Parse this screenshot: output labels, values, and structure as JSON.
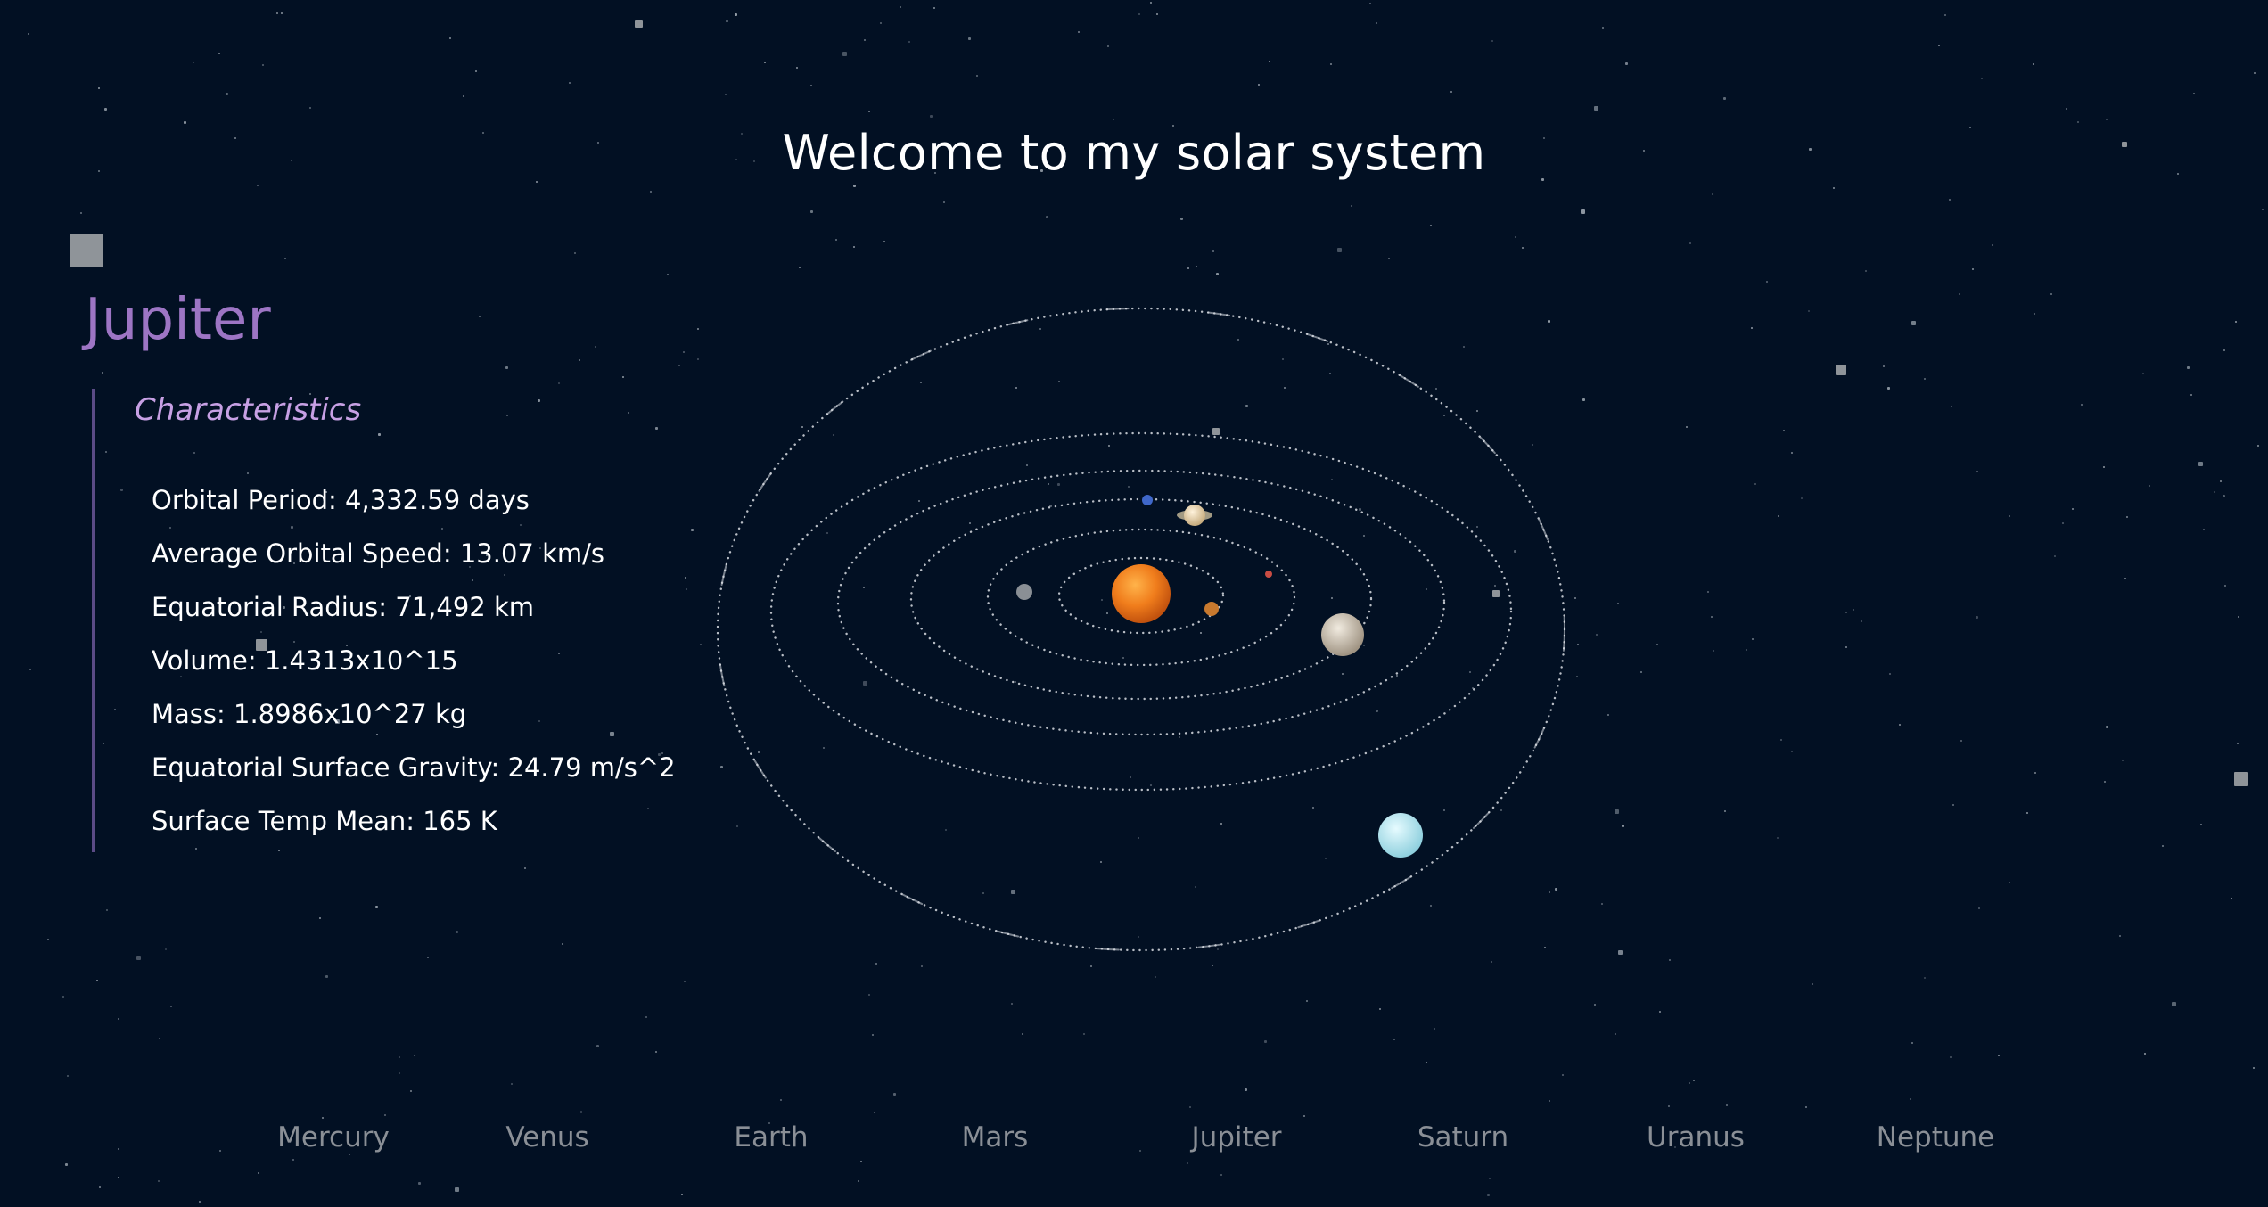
{
  "header": {
    "title": "Welcome to my solar system"
  },
  "planet": {
    "name": "Jupiter",
    "characteristics_heading": "Characteristics",
    "stats": [
      "Orbital Period: 4,332.59 days",
      "Average Orbital Speed: 13.07 km/s",
      "Equatorial Radius: 71,492 km",
      "Volume: 1.4313x10^15",
      "Mass: 1.8986x10^27 kg",
      "Equatorial Surface Gravity: 24.79 m/s^2",
      "Surface Temp Mean: 165 K"
    ]
  },
  "nav": [
    "Mercury",
    "Venus",
    "Earth",
    "Mars",
    "Jupiter",
    "Saturn",
    "Uranus",
    "Neptune"
  ],
  "colors": {
    "background": "#021023",
    "title_text": "#ffffff",
    "planet_name": "#9d75c4",
    "characteristics_heading": "#c7a0e4",
    "panel_border": "#5b4b86",
    "nav_text": "#8a8f96",
    "orbit_dots": "#d9dde3",
    "sun": "#f07d1c",
    "star": "#9aa3ad"
  }
}
